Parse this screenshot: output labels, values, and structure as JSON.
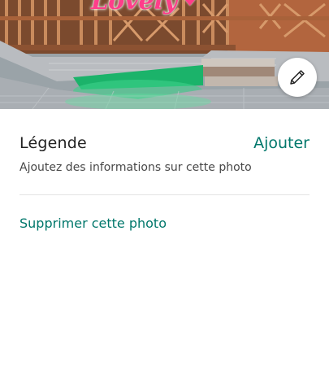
{
  "photo": {
    "overlay_text": "Lovely"
  },
  "caption": {
    "title": "Légende",
    "add_label": "Ajouter",
    "hint": "Ajoutez des informations sur cette photo"
  },
  "actions": {
    "delete_label": "Supprimer cette photo"
  },
  "colors": {
    "accent": "#00776b",
    "text_primary": "#222222",
    "text_secondary": "#484848",
    "divider": "#e4e4e4"
  },
  "icons": {
    "edit": "pencil-icon"
  }
}
